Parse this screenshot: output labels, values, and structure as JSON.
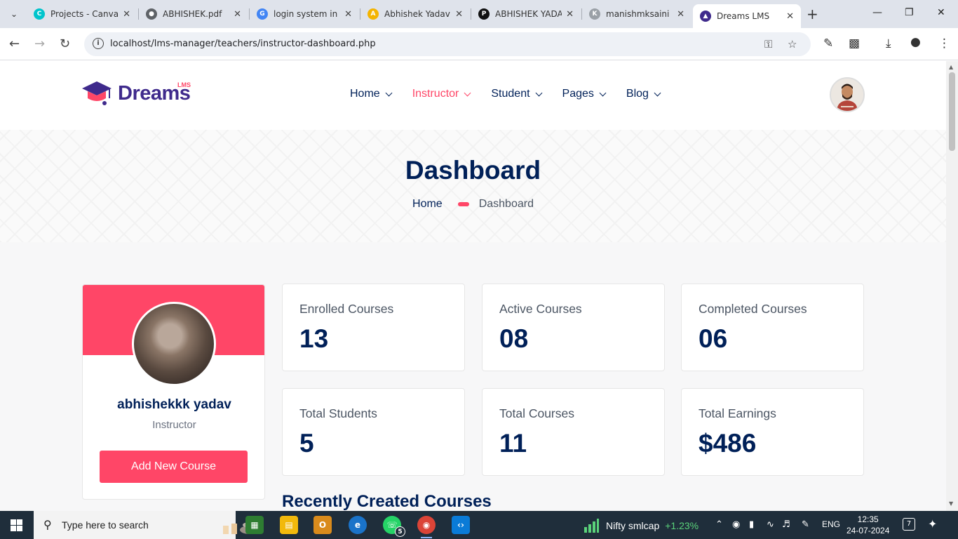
{
  "browser": {
    "tabs": [
      {
        "title": "Projects - Canva",
        "fav_color": "#00c4cc",
        "icon": "canva-icon"
      },
      {
        "title": "ABHISHEK.pdf",
        "fav_color": "#5f6368",
        "icon": "globe-icon"
      },
      {
        "title": "login system in p",
        "fav_color": "#4285f4",
        "icon": "google-icon"
      },
      {
        "title": "Abhishek Yadav",
        "fav_color": "#f4b400",
        "icon": "portfolio-icon"
      },
      {
        "title": "ABHISHEK YADA",
        "fav_color": "#111111",
        "icon": "p-logo-icon"
      },
      {
        "title": "manishmksaini",
        "fav_color": "#9aa0a6",
        "icon": "mk-logo-icon"
      },
      {
        "title": "Dreams LMS",
        "fav_color": "#3f2a8c",
        "icon": "graduation-cap-icon"
      }
    ],
    "active_tab_index": 6,
    "url": "localhost/lms-manager/teachers/instructor-dashboard.php"
  },
  "site": {
    "logo_text": "Dreams",
    "logo_sup": "LMS",
    "nav": [
      {
        "label": "Home",
        "active": false
      },
      {
        "label": "Instructor",
        "active": true
      },
      {
        "label": "Student",
        "active": false
      },
      {
        "label": "Pages",
        "active": false
      },
      {
        "label": "Blog",
        "active": false
      }
    ],
    "accent": "#ff4667",
    "navy": "#002058"
  },
  "hero": {
    "title": "Dashboard",
    "breadcrumb_home": "Home",
    "breadcrumb_current": "Dashboard"
  },
  "profile": {
    "name": "abhishekkk yadav",
    "role": "Instructor",
    "button": "Add New Course"
  },
  "stats": [
    {
      "label": "Enrolled Courses",
      "value": "13"
    },
    {
      "label": "Active Courses",
      "value": "08"
    },
    {
      "label": "Completed Courses",
      "value": "06"
    },
    {
      "label": "Total Students",
      "value": "5"
    },
    {
      "label": "Total Courses",
      "value": "11"
    },
    {
      "label": "Total Earnings",
      "value": "$486"
    }
  ],
  "recent_heading": "Recently Created Courses",
  "taskbar": {
    "search_placeholder": "Type here to search",
    "whatsapp_badge": "5",
    "ticker_name": "Nifty smlcap",
    "ticker_change": "+1.23%",
    "language": "ENG",
    "time": "12:35",
    "date": "24-07-2024",
    "notifications": "7"
  }
}
